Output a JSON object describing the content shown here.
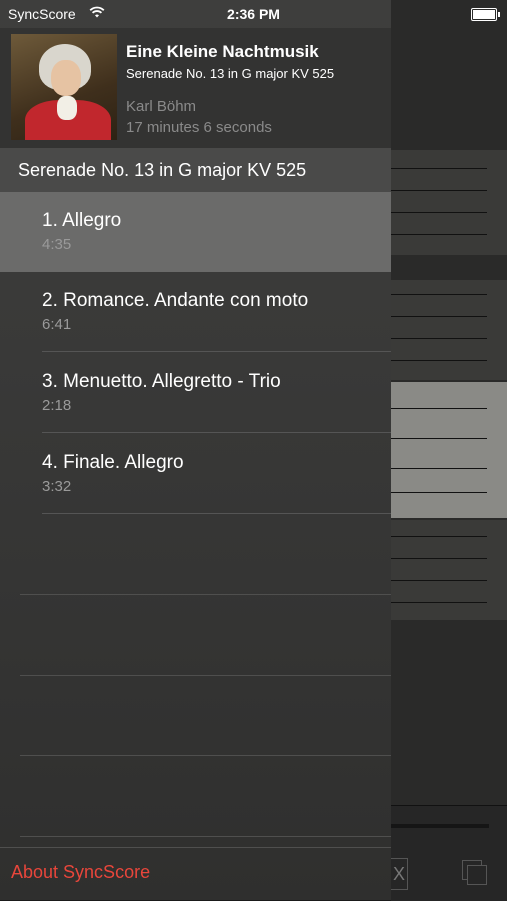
{
  "status_bar": {
    "carrier": "SyncScore",
    "time": "2:36 PM"
  },
  "header": {
    "title": "Eine Kleine Nachtmusik",
    "subtitle": "Serenade No. 13 in G major KV 525",
    "performer": "Karl Böhm",
    "duration": "17 minutes 6 seconds"
  },
  "section": {
    "title": "Serenade No. 13 in G major KV 525"
  },
  "tracks": [
    {
      "name": "1. Allegro",
      "time": "4:35"
    },
    {
      "name": "2. Romance. Andante con moto",
      "time": "6:41"
    },
    {
      "name": "3. Menuetto. Allegretto - Trio",
      "time": "2:18"
    },
    {
      "name": "4. Finale. Allegro",
      "time": "3:32"
    }
  ],
  "selected_track_index": 0,
  "footer": {
    "about_label": "About SyncScore"
  },
  "score_controls": {
    "close_label": "X"
  },
  "colors": {
    "accent": "#e8463b",
    "selected_row": "#6b6b6a"
  }
}
